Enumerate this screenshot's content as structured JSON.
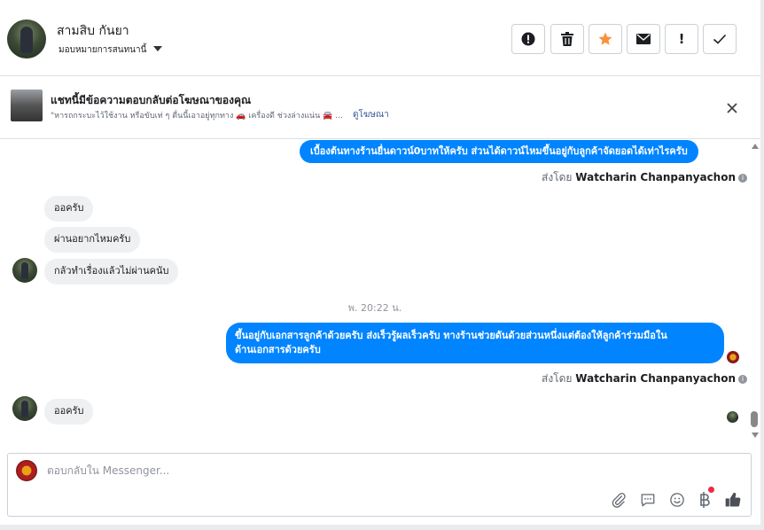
{
  "header": {
    "contact_name": "สามสิบ กันยา",
    "assign_label": "มอบหมายการสนทนานี้",
    "buttons": {
      "spam": "!",
      "followup": "!"
    }
  },
  "ad_banner": {
    "title": "แชทนี้มีข้อความตอบกลับต่อโฆษณาของคุณ",
    "snippet": "\"หารถกระบะไว้ใช้งาน หรือขับเท่ ๆ ตื่นนี้เอาอยู่ทุกทาง 🚗 เครื่องดี ช่วงล่างแน่น 🚘 ...",
    "link": "ดูโฆษณา"
  },
  "messages": {
    "out1": "เบื้องต้นทางร้านยื่นดาวน์0บาทให้ครับ ส่วนได้ดาวน์ไหมขึ้นอยู่กับลูกค้าจัดยอดได้เท่าไรครับ",
    "sent_by_prefix_1": "ส่งโดย ",
    "sent_by_name_1": "Watcharin Chanpanyachon",
    "in1": "ออครับ",
    "in2": "ผ่านอยากไหมครับ",
    "in3": "กลัวทำเรื่องแล้วไม่ผ่านคนับ",
    "timestamp": "พ. 20:22 น.",
    "out2_line1": "ขึ้นอยู่กับเอกสารลูกค้าด้วยครับ ส่งเร็วรู้ผลเร็วครับ ทางร้านช่วยดันด้วยส่วนหนึ่งแต่ต้องให้ลูกค้าร่วมมือใน",
    "out2_line2": "ด้านเอกสารด้วยครับ",
    "sent_by_prefix_2": "ส่งโดย ",
    "sent_by_name_2": "Watcharin Chanpanyachon",
    "in4": "ออครับ"
  },
  "composer": {
    "placeholder": "ตอบกลับใน Messenger..."
  },
  "colors": {
    "accent": "#0084ff",
    "star": "#f7923a",
    "notification": "#f02849"
  },
  "icons": [
    "spam-icon",
    "trash-icon",
    "star-icon",
    "envelope-icon",
    "exclamation-icon",
    "check-icon",
    "close-icon",
    "paperclip-icon",
    "saved-reply-icon",
    "emoji-icon",
    "baht-icon",
    "thumbs-up-icon"
  ]
}
